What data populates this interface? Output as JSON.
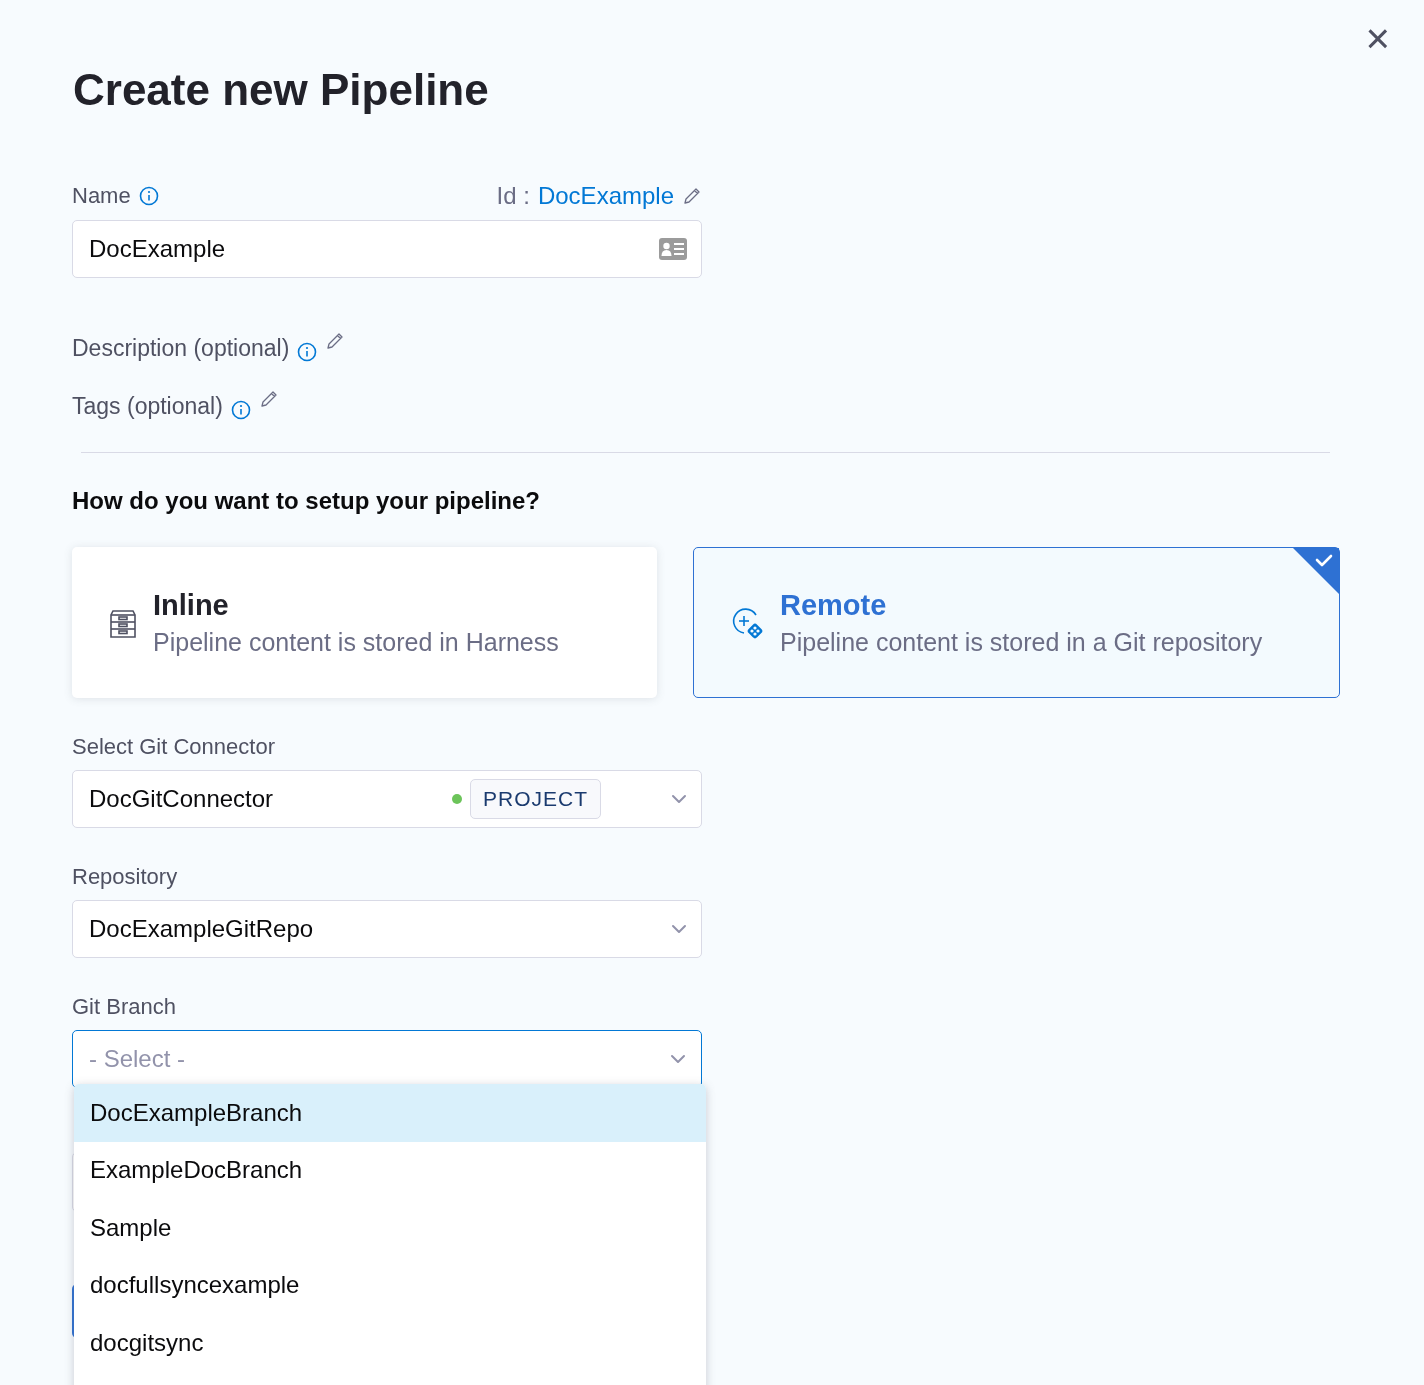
{
  "dialog": {
    "title": "Create new Pipeline",
    "close": "×"
  },
  "name_field": {
    "label": "Name",
    "id_label": "Id :",
    "id_value": "DocExample",
    "value": "DocExample"
  },
  "optional_fields": [
    {
      "label": "Description (optional)"
    },
    {
      "label": "Tags (optional)"
    }
  ],
  "setup": {
    "question": "How do you want to setup your pipeline?",
    "options": [
      {
        "kind": "inline",
        "title": "Inline",
        "subtitle": "Pipeline content is stored in Harness",
        "selected": false
      },
      {
        "kind": "remote",
        "title": "Remote",
        "subtitle": "Pipeline content is stored in a Git repository",
        "selected": true
      }
    ]
  },
  "git_connector": {
    "label": "Select Git Connector",
    "value": "DocGitConnector",
    "scope": "PROJECT",
    "color": "#6cc45a"
  },
  "repository": {
    "label": "Repository",
    "value": "DocExampleGitRepo"
  },
  "git_branch": {
    "label": "Git Branch",
    "placeholder": "- Select -",
    "options": [
      {
        "label": "DocExampleBranch",
        "selected": true
      },
      {
        "label": "ExampleDocBranch",
        "selected": false
      },
      {
        "label": "Sample",
        "selected": false
      },
      {
        "label": "docfullsyncexample",
        "selected": false
      },
      {
        "label": "docgitsync",
        "selected": false
      }
    ]
  }
}
